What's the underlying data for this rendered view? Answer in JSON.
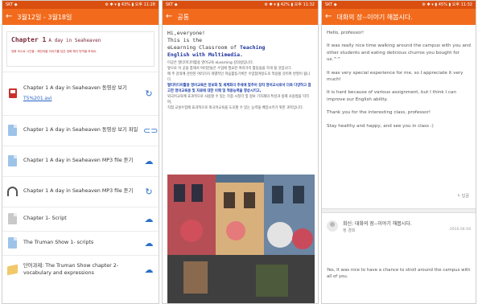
{
  "phone1": {
    "status_left": "SKT ◆",
    "status_right": "⚙ ✱ ▾ ▮ 43% ▮ 오후 11:28",
    "appbar_title": "3월12일 - 3월18일",
    "banner": {
      "title": "Chapter 1",
      "title_sub": "A day in Seaheaven",
      "subtitle": "영화 속으로 시간을 : 해안마을 이야기를 담은 영화 해석 번역을 하세요."
    },
    "items": [
      {
        "label": "Chapter 1 A day in Seaheaven 동영상 보기",
        "link": "T5%201.avi",
        "icon": "video-file-icon",
        "action": "refresh-icon"
      },
      {
        "label": "Chapter 1 A day in Seaheaven 동영상 보기 파일",
        "icon": "document-icon",
        "action": "link-icon"
      },
      {
        "label": "Chapter 1 A day in Seaheaven MP3 file 듣기",
        "icon": "document-icon",
        "action": "cloud-download-icon"
      },
      {
        "label": "Chapter 1 A day in Seaheaven MP3 file 듣기",
        "icon": "headphones-icon",
        "action": "refresh-icon"
      },
      {
        "label": "Chapter 1- Script",
        "icon": "document-icon",
        "action": "cloud-download-icon"
      },
      {
        "label": "The Truman Show 1- scripts",
        "icon": "document-icon",
        "action": "cloud-download-icon"
      },
      {
        "label": "단어과제: The Truman Show chapter 2- vocabulary and expressions",
        "icon": "book-icon",
        "action": "cloud-download-icon"
      }
    ]
  },
  "phone2": {
    "status_left": "SKT ◆",
    "status_right": "⚙ ✱ ▾ ▮ 42% ▮ 오후 11:32",
    "appbar_title": "공통",
    "greeting_lines": [
      "Hi,everyone!",
      "This is the",
      "eLearning Classroom of"
    ],
    "highlight_1": "Teaching",
    "highlight_2": "English with Multimedia.",
    "kor_lines": [
      "이곳은 멀티미디어활용 영어교육 eLearning 강의실입니다.",
      "앞으로 이 곳을 통해서 여러분들은 수업에 필요한 여러가지 활동들을 하게 될 것입니다.",
      "매 주 강의에 관련된 여러가지 개별적인 학습활동기록은 수업참여정도로 적용될 것이며 반영이 됩니다.",
      "멀티미디어활용 영어교육은 정보화 및 세계화의 추세에 맞추어 장차 영어교사로서 더욱 다양하고 참고한 영어교육용 및 자료에 대한 이해 및 적용능력을 향상시키고,",
      "외국어교육에 효과적으로 사용할 수 있는 각종 시청각 및 정보 기자재의 특성과 실제 사용법을 익히며,",
      "직접 교실수업에 효과적으로 외국어교육을 도모할 수 있는 능력을 배양시키기 위한 과목입니다."
    ]
  },
  "phone3": {
    "status_left": "SKT ◆",
    "status_right": "⚙ ✱ ▾ ▮ 45% ▮ 오후 11:32",
    "appbar_title": "대화의 장--이야기 해봅시다.",
    "paragraphs": [
      "Hello, professor!",
      "It was really nice time walking around the campus with you and other students and eating delicious churros you bought for us.^^",
      "It was very special experience for me, so I appreciate it very much!",
      "It is hard because of various assignment, but I think I can improve our English ability.",
      "Thank you for the interesting class, professor!",
      "Stay healthy and happy, and see you in class :)"
    ],
    "reply_label": "↰ 답글",
    "comment": {
      "title": "회신: 대화의 장--이야기 해봅시다.",
      "author": "정 경희",
      "date": "2016.04.04"
    },
    "comment_body": "Yes, It was nice to have a chance to stroll around the campus with all of you."
  }
}
